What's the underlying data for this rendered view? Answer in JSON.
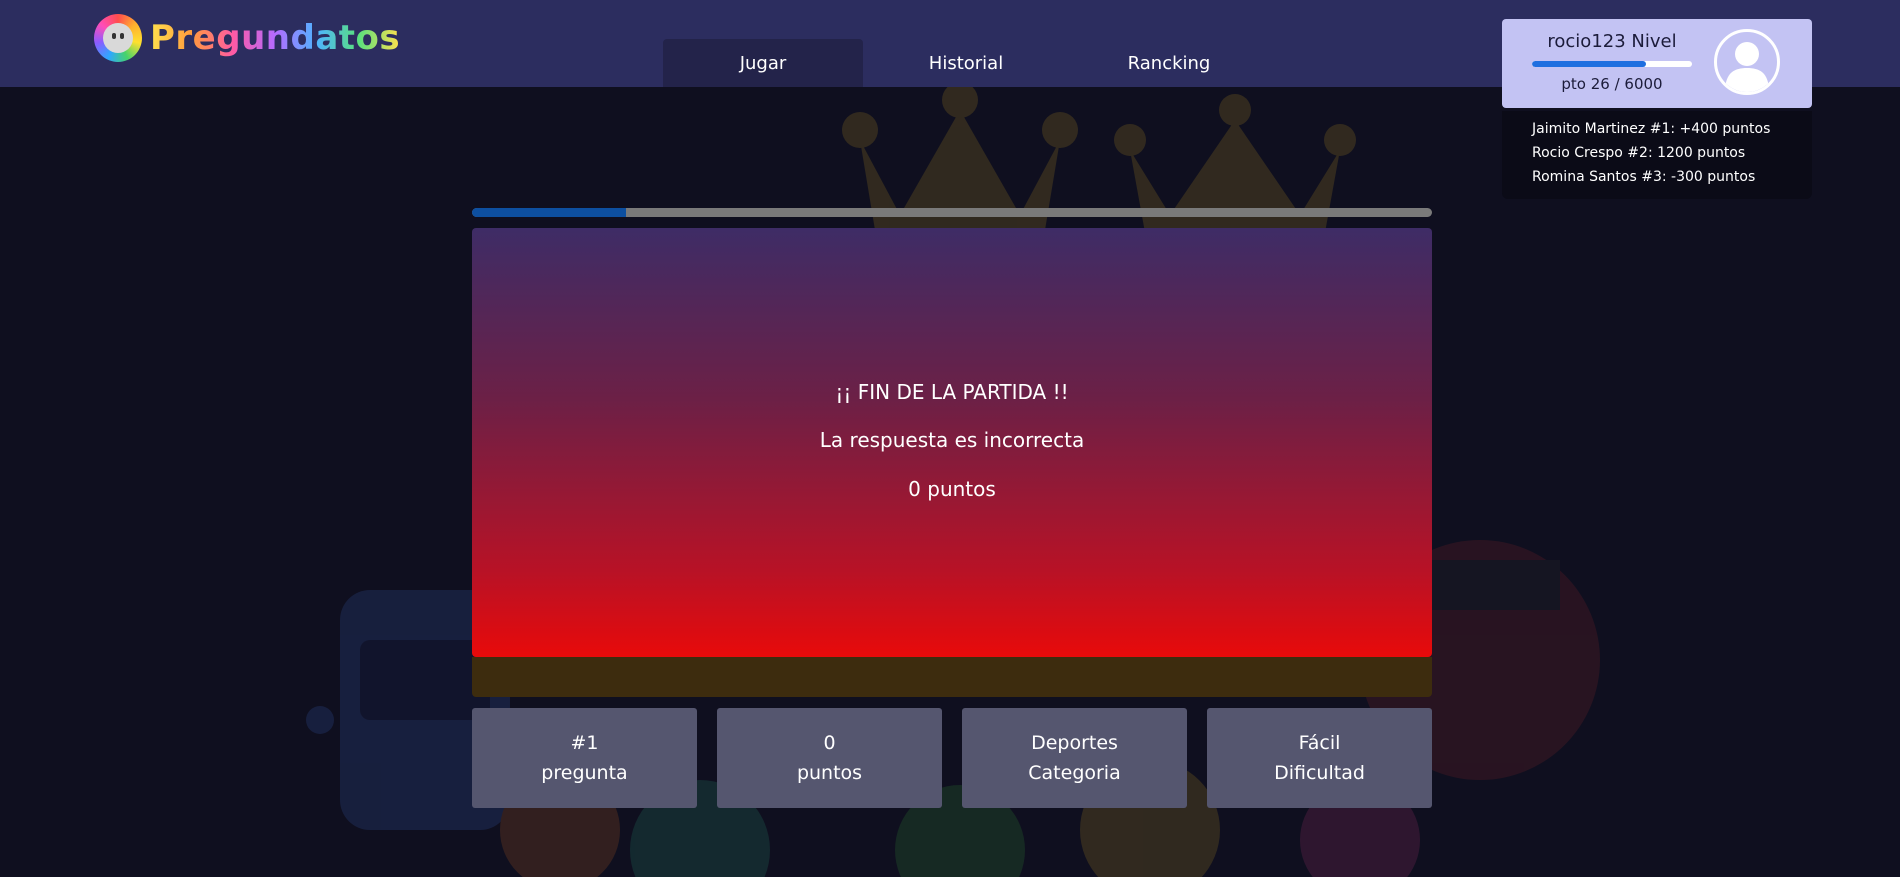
{
  "app": {
    "logo_text": "Pregundatos"
  },
  "nav": {
    "tabs": [
      {
        "label": "Jugar",
        "active": true
      },
      {
        "label": "Historial",
        "active": false
      },
      {
        "label": "Rancking",
        "active": false
      }
    ]
  },
  "profile": {
    "name_level": "rocio123 Nivel",
    "points_text": "pto 26 / 6000",
    "level_progress_percent": 71,
    "avatar_icon": "user-silhouette-icon"
  },
  "ranking": {
    "entries": [
      "Jaimito Martinez #1: +400 puntos",
      "Rocio Crespo #2: 1200 puntos",
      "Romina Santos #3: -300 puntos"
    ]
  },
  "question_progress_percent": 16,
  "result": {
    "title": "¡¡ FIN DE LA PARTIDA !!",
    "message": "La respuesta es incorrecta",
    "points": "0 puntos"
  },
  "stats": [
    {
      "value": "#1",
      "label": "pregunta"
    },
    {
      "value": "0",
      "label": "puntos"
    },
    {
      "value": "Deportes",
      "label": "Categoria"
    },
    {
      "value": "Fácil",
      "label": "Dificultad"
    }
  ],
  "colors": {
    "topbar": "#2c2d5f",
    "background": "#0f0f1f",
    "profile_card": "#c3c3f3",
    "level_fill": "#1f6fe0",
    "progress_fill": "#0d4fa0",
    "panel_top": "#3e2c66",
    "panel_bottom": "#e80a0a",
    "stat_box": "#55566f"
  }
}
